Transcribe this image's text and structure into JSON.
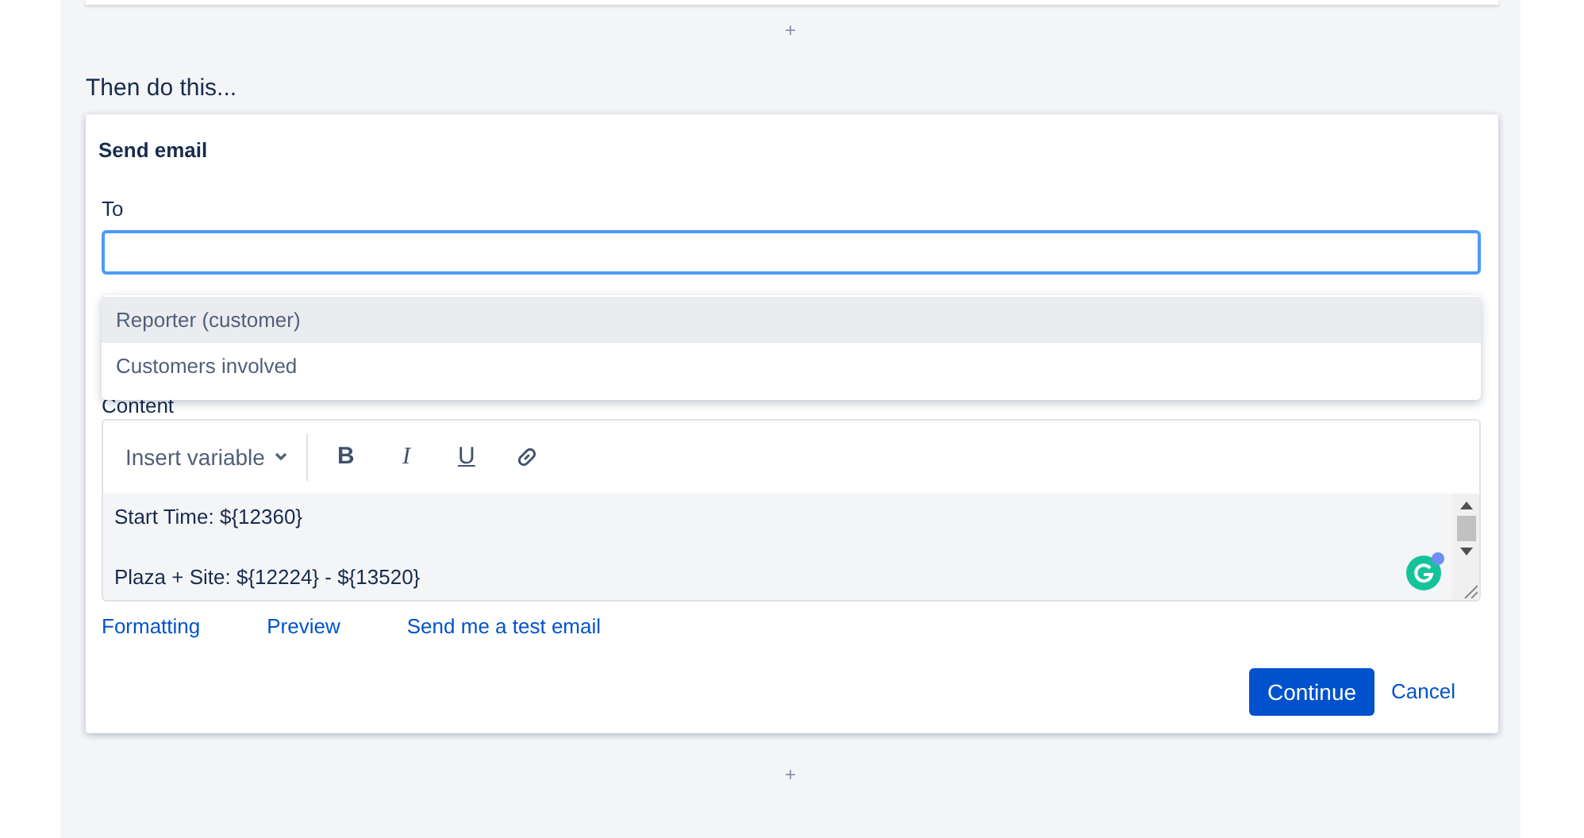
{
  "heading": "Then do this...",
  "card": {
    "title": "Send email",
    "to": {
      "label": "To"
    },
    "suggestions": [
      {
        "label": "Reporter (customer)",
        "selected": true
      },
      {
        "label": "Customers involved",
        "selected": false
      }
    ],
    "content": {
      "label": "Content",
      "insert_variable": "Insert variable",
      "toolbar": [
        {
          "kind": "bold",
          "label": "B"
        },
        {
          "kind": "italic",
          "label": "I"
        },
        {
          "kind": "underline",
          "label": "U"
        },
        {
          "kind": "link"
        }
      ],
      "paragraphs": [
        "Start Time: ${12360}",
        "Plaza + Site: ${12224} - ${13520}"
      ]
    },
    "links": [
      "Formatting",
      "Preview",
      "Send me a test email"
    ],
    "buttons": {
      "primary": "Continue",
      "secondary": "Cancel"
    }
  },
  "add_top": "+",
  "add_bottom": "+"
}
